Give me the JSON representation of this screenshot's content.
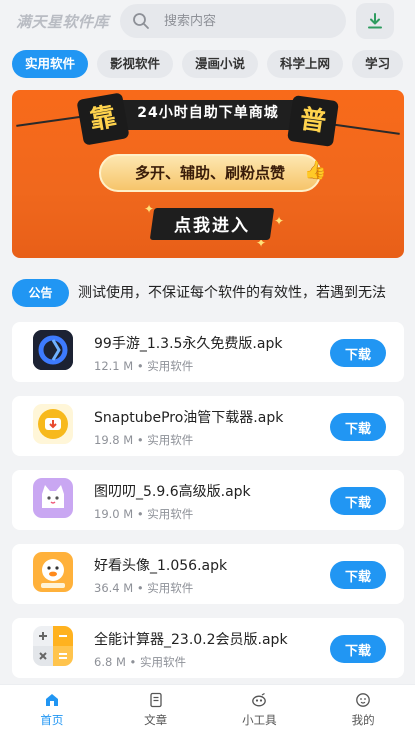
{
  "header": {
    "app_name": "满天星软件库",
    "search": {
      "placeholder": "搜索内容",
      "value": ""
    },
    "icons": {
      "search": "search-icon",
      "download": "download-icon"
    }
  },
  "tabs": [
    {
      "label": "实用软件",
      "active": true
    },
    {
      "label": "影视软件",
      "active": false
    },
    {
      "label": "漫画小说",
      "active": false
    },
    {
      "label": "科学上网",
      "active": false
    },
    {
      "label": "学习",
      "active": false
    }
  ],
  "banner": {
    "title": "24小时自助下单商城",
    "subtitle": "多开、辅助、刷粉点赞",
    "cta": "点我进入",
    "seal_left": "靠",
    "seal_right": "普"
  },
  "notice": {
    "badge": "公告",
    "text": "测试使用，不保证每个软件的有效性，若遇到无法"
  },
  "apps": [
    {
      "name": "99手游_1.3.5永久免费版.apk",
      "size": "12.1 M",
      "category": "实用软件",
      "icon": "99-game-app-icon"
    },
    {
      "name": "SnaptubePro油管下载器.apk",
      "size": "19.8 M",
      "category": "实用软件",
      "icon": "snaptube-app-icon"
    },
    {
      "name": "图叨叨_5.9.6高级版.apk",
      "size": "19.0 M",
      "category": "实用软件",
      "icon": "tudaodao-app-icon"
    },
    {
      "name": "好看头像_1.056.apk",
      "size": "36.4 M",
      "category": "实用软件",
      "icon": "avatar-app-icon"
    },
    {
      "name": "全能计算器_23.0.2会员版.apk",
      "size": "6.8 M",
      "category": "实用软件",
      "icon": "calculator-app-icon"
    }
  ],
  "download_label": "下载",
  "meta_separator": " • ",
  "nav": [
    {
      "label": "首页",
      "icon": "home-icon",
      "active": true
    },
    {
      "label": "文章",
      "icon": "article-icon",
      "active": false
    },
    {
      "label": "小工具",
      "icon": "tools-icon",
      "active": false
    },
    {
      "label": "我的",
      "icon": "profile-icon",
      "active": false
    }
  ],
  "colors": {
    "accent": "#2196f3",
    "background": "#f2f3f5",
    "banner_orange": "#f0681d",
    "muted_text": "#8e9198"
  }
}
